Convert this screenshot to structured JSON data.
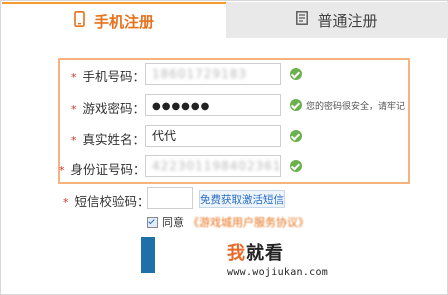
{
  "tabs": [
    {
      "label": "手机注册",
      "icon": "phone-icon",
      "active": true
    },
    {
      "label": "普通注册",
      "icon": "document-icon",
      "active": false
    }
  ],
  "colors": {
    "accent": "#e8711b",
    "success": "#6ab04c",
    "required": "#d9302a",
    "link": "#2a6fc4"
  },
  "form": {
    "phone": {
      "label": "手机号码：",
      "value": "18601729183"
    },
    "password": {
      "label": "游戏密码：",
      "value": "●●●●●●",
      "hint": "您的密码很安全，请牢记"
    },
    "realname": {
      "label": "真实姓名：",
      "value": "代代"
    },
    "idcard": {
      "label": "身份证号码：",
      "value": "422301198402361217"
    },
    "sms": {
      "label": "短信校验码：",
      "value": "",
      "button": "免费获取激活短信"
    },
    "agree": {
      "label": "同意",
      "link": "《游戏城用户服务协议》"
    }
  },
  "watermark": {
    "brand_highlight": "我",
    "brand_rest": "就看",
    "url": "www.wojiukan.com"
  }
}
